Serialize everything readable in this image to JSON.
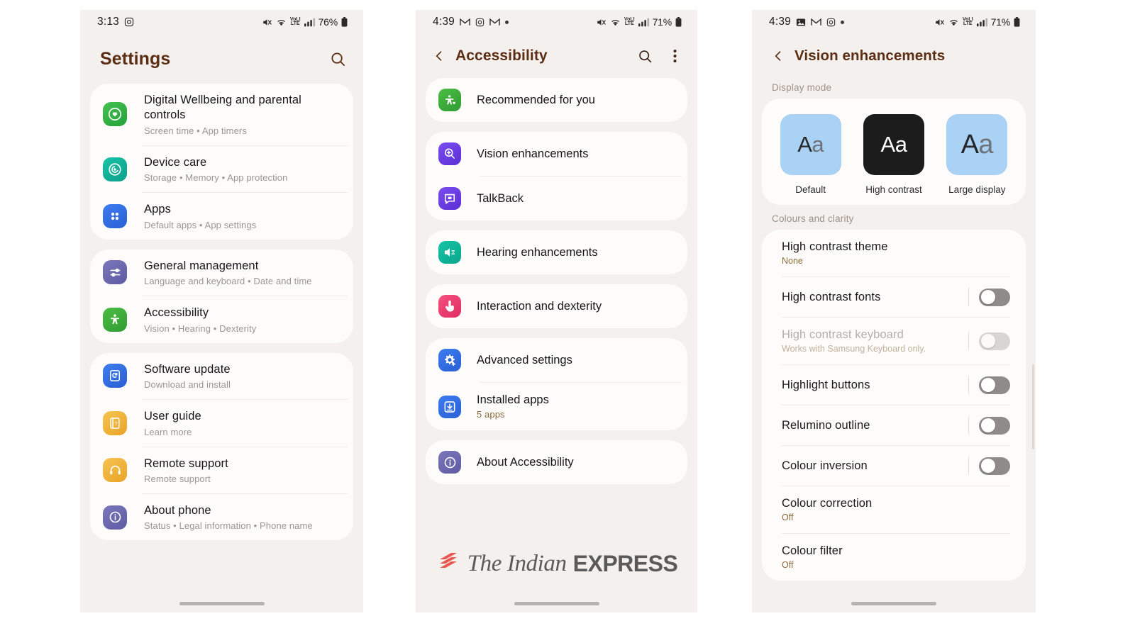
{
  "panels": [
    {
      "id": "settings",
      "status": {
        "time": "3:13",
        "left_icons": [
          "instagram-icon"
        ],
        "right_icons": [
          "mute-icon",
          "wifi-icon",
          "volte-icon",
          "signal-icon"
        ],
        "battery": "76%"
      },
      "appbar": {
        "title": "Settings",
        "search_icon": "search-icon"
      },
      "groups": [
        {
          "rows": [
            {
              "title": "Digital Wellbeing and parental controls",
              "sub": "Screen time  •  App timers",
              "icon": "digital-wellbeing-icon",
              "icon_color": "#3ab54a"
            },
            {
              "title": "Device care",
              "sub": "Storage  •  Memory  •  App protection",
              "icon": "device-care-icon",
              "icon_color": "#13b39a"
            },
            {
              "title": "Apps",
              "sub": "Default apps  •  App settings",
              "icon": "apps-icon",
              "icon_color": "#2f6fe4"
            }
          ]
        },
        {
          "rows": [
            {
              "title": "General management",
              "sub": "Language and keyboard  •  Date and time",
              "icon": "sliders-icon",
              "icon_color": "#6d6aab"
            },
            {
              "title": "Accessibility",
              "sub": "Vision  •  Hearing  •  Dexterity",
              "icon": "accessibility-icon",
              "icon_color": "#3eae3a"
            }
          ]
        },
        {
          "rows": [
            {
              "title": "Software update",
              "sub": "Download and install",
              "icon": "update-icon",
              "icon_color": "#2f6fe4"
            },
            {
              "title": "User guide",
              "sub": "Learn more",
              "icon": "user-guide-icon",
              "icon_color": "#f2b43c"
            },
            {
              "title": "Remote support",
              "sub": "Remote support",
              "icon": "headset-icon",
              "icon_color": "#f2b43c"
            },
            {
              "title": "About phone",
              "sub": "Status  •  Legal information  •  Phone name",
              "icon": "info-icon",
              "icon_color": "#6d6aab"
            }
          ]
        }
      ]
    },
    {
      "id": "accessibility",
      "status": {
        "time": "4:39",
        "left_icons": [
          "gmail-icon",
          "instagram-icon",
          "gmail-icon",
          "dot-icon"
        ],
        "right_icons": [
          "mute-icon",
          "wifi-icon",
          "volte-icon",
          "signal-icon"
        ],
        "battery": "71%"
      },
      "appbar": {
        "title": "Accessibility",
        "back_icon": "back-chevron-icon",
        "search_icon": "search-icon",
        "more_icon": "more-vertical-icon"
      },
      "groups": [
        {
          "rows": [
            {
              "title": "Recommended for you",
              "icon": "accessibility-heart-icon",
              "icon_color": "#3eae3a"
            }
          ]
        },
        {
          "rows": [
            {
              "title": "Vision enhancements",
              "icon": "magnifier-plus-icon",
              "icon_color": "#6540e0"
            },
            {
              "title": "TalkBack",
              "icon": "talkback-icon",
              "icon_color": "#6540e0"
            }
          ]
        },
        {
          "rows": [
            {
              "title": "Hearing enhancements",
              "icon": "speaker-icon",
              "icon_color": "#12b398"
            }
          ]
        },
        {
          "rows": [
            {
              "title": "Interaction and dexterity",
              "icon": "tap-icon",
              "icon_color": "#ef4270"
            }
          ]
        },
        {
          "rows": [
            {
              "title": "Advanced settings",
              "icon": "gear-plus-icon",
              "icon_color": "#2f6fe4"
            },
            {
              "title": "Installed apps",
              "sub": "5 apps",
              "icon": "download-icon",
              "icon_color": "#2f6fe4"
            }
          ]
        },
        {
          "rows": [
            {
              "title": "About Accessibility",
              "icon": "info-icon",
              "icon_color": "#6d6aab"
            }
          ]
        }
      ],
      "watermark": {
        "part1": "The Indian",
        "part2": "EXPRESS",
        "logo": "indian-express-logo"
      }
    },
    {
      "id": "vision",
      "status": {
        "time": "4:39",
        "left_icons": [
          "photos-icon",
          "gmail-icon",
          "instagram-icon",
          "dot-icon"
        ],
        "right_icons": [
          "mute-icon",
          "wifi-icon",
          "volte-icon",
          "signal-icon"
        ],
        "battery": "71%"
      },
      "appbar": {
        "title": "Vision enhancements",
        "back_icon": "back-chevron-icon"
      },
      "display_mode": {
        "label": "Display mode",
        "modes": [
          {
            "label": "Default",
            "sample": "Aa",
            "bg": "#a9d2f5",
            "fg1": "#27272a",
            "fg2": "#6f7278",
            "large": false
          },
          {
            "label": "High contrast",
            "sample": "Aa",
            "bg": "#1c1c1c",
            "fg1": "#ffffff",
            "fg2": "#ffffff",
            "large": false
          },
          {
            "label": "Large display",
            "sample": "Aa",
            "bg": "#a9d2f5",
            "fg1": "#27272a",
            "fg2": "#6f7278",
            "large": true
          }
        ]
      },
      "colours_label": "Colours and clarity",
      "settings": [
        {
          "title": "High contrast theme",
          "sub": "None",
          "control": "none",
          "dimmed": false
        },
        {
          "title": "High contrast fonts",
          "sub": "",
          "control": "toggle",
          "toggle_on": false,
          "dimmed": false
        },
        {
          "title": "High contrast keyboard",
          "sub": "Works with Samsung Keyboard only.",
          "control": "toggle",
          "toggle_on": false,
          "dimmed": true
        },
        {
          "title": "Highlight buttons",
          "sub": "",
          "control": "toggle",
          "toggle_on": false,
          "dimmed": false
        },
        {
          "title": "Relumino outline",
          "sub": "",
          "control": "toggle",
          "toggle_on": false,
          "dimmed": false
        },
        {
          "title": "Colour inversion",
          "sub": "",
          "control": "toggle",
          "toggle_on": false,
          "dimmed": false
        },
        {
          "title": "Colour correction",
          "sub": "Off",
          "control": "none",
          "dimmed": false
        },
        {
          "title": "Colour filter",
          "sub": "Off",
          "control": "none",
          "dimmed": false
        }
      ]
    }
  ],
  "theme": {
    "page_bg": "#f4f0ee",
    "card_bg": "#fdfcfb",
    "title_accent": "#5c2e14",
    "sub_accent": "#8a6a3c"
  }
}
